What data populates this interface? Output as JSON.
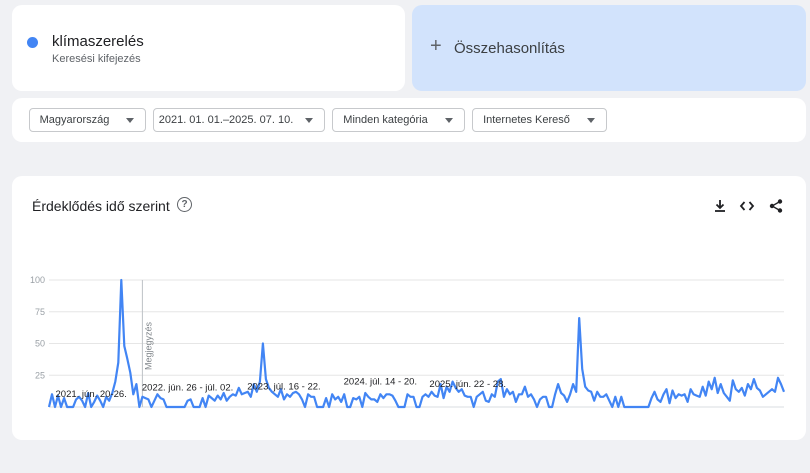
{
  "term": {
    "name": "klímaszerelés",
    "type": "Keresési kifejezés",
    "color": "#4285f4"
  },
  "compare": {
    "label": "Összehasonlítás",
    "icon": "plus-icon"
  },
  "filters": {
    "country": "Magyarország",
    "date_range": "2021. 01. 01.–2025. 07. 10.",
    "category": "Minden kategória",
    "search_type": "Internetes Kereső"
  },
  "chart": {
    "title": "Érdeklődés idő szerint",
    "help_icon": "question-circle-icon",
    "tools": [
      "download-icon",
      "embed-code-icon",
      "share-icon"
    ]
  },
  "chart_data": {
    "type": "line",
    "x_start": "2021-01",
    "x_end": "2025-07",
    "ylim": [
      0,
      100
    ],
    "yticks": [
      25,
      50,
      75,
      100
    ],
    "grid": true,
    "note_label": "Megjegyzés",
    "note_index": 31,
    "annotations": [
      {
        "index": 14,
        "label": "2021. jún. 20-26."
      },
      {
        "index": 46,
        "label": "2022. jún. 26 - júl. 02."
      },
      {
        "index": 78,
        "label": "2023. júl. 16 - 22."
      },
      {
        "index": 110,
        "label": "2024. júl. 14 - 20."
      },
      {
        "index": 139,
        "label": "2025. jún. 22 - 28."
      }
    ],
    "series": [
      {
        "color": "#4285f4",
        "values": [
          0,
          10,
          0,
          9,
          0,
          7,
          0,
          0,
          0,
          6,
          8,
          5,
          0,
          11,
          0,
          4,
          9,
          5,
          0,
          8,
          5,
          11,
          20,
          35,
          100,
          48,
          38,
          27,
          10,
          18,
          0,
          8,
          7,
          6,
          0,
          5,
          10,
          7,
          6,
          0,
          0,
          0,
          0,
          0,
          0,
          0,
          5,
          6,
          0,
          0,
          0,
          7,
          0,
          9,
          7,
          5,
          9,
          6,
          11,
          5,
          8,
          10,
          9,
          15,
          10,
          11,
          12,
          8,
          18,
          12,
          20,
          50,
          22,
          15,
          12,
          10,
          8,
          14,
          6,
          10,
          8,
          11,
          12,
          10,
          6,
          0,
          10,
          8,
          8,
          0,
          0,
          0,
          7,
          0,
          10,
          6,
          8,
          4,
          10,
          0,
          0,
          7,
          6,
          8,
          0,
          11,
          8,
          6,
          6,
          4,
          10,
          7,
          10,
          10,
          9,
          5,
          0,
          0,
          0,
          10,
          8,
          8,
          0,
          0,
          8,
          10,
          8,
          12,
          9,
          8,
          18,
          7,
          16,
          12,
          20,
          15,
          12,
          14,
          9,
          8,
          8,
          0,
          8,
          10,
          12,
          5,
          4,
          10,
          8,
          20,
          22,
          8,
          14,
          10,
          12,
          4,
          10,
          10,
          16,
          8,
          10,
          6,
          0,
          6,
          8,
          8,
          0,
          0,
          10,
          18,
          11,
          9,
          4,
          10,
          18,
          12,
          70,
          30,
          16,
          13,
          12,
          5,
          12,
          8,
          8,
          10,
          5,
          0,
          8,
          0,
          8,
          0,
          0,
          0,
          0,
          0,
          0,
          0,
          0,
          0,
          7,
          12,
          6,
          4,
          10,
          14,
          3,
          13,
          7,
          10,
          9,
          10,
          4,
          14,
          10,
          9,
          8,
          16,
          9,
          20,
          14,
          23,
          11,
          18,
          11,
          8,
          5,
          21,
          14,
          12,
          15,
          9,
          18,
          14,
          22,
          15,
          13,
          8,
          10,
          12,
          14,
          12,
          23,
          18,
          12
        ]
      }
    ]
  }
}
